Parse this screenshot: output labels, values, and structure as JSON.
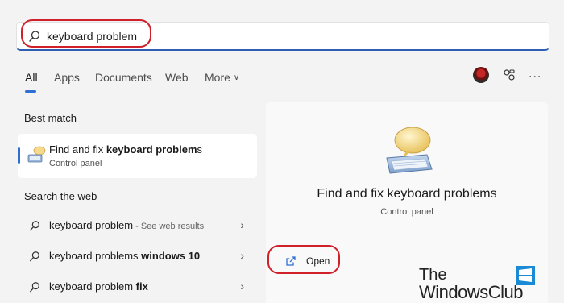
{
  "search": {
    "query": "keyboard problem"
  },
  "tabs": [
    {
      "label": "All",
      "active": true
    },
    {
      "label": "Apps"
    },
    {
      "label": "Documents"
    },
    {
      "label": "Web"
    },
    {
      "label": "More"
    }
  ],
  "header_icons": {
    "avatar": "avatar",
    "share": "share-icon",
    "more": "..."
  },
  "best_match": {
    "section": "Best match",
    "title_prefix": "Find and fix ",
    "title_bold": "keyboard problem",
    "title_suffix": "s",
    "subtitle": "Control panel"
  },
  "web": {
    "section": "Search the web",
    "items": [
      {
        "text": "keyboard problem",
        "bold": "",
        "hint": " - See web results"
      },
      {
        "text": "keyboard problems ",
        "bold": "windows 10",
        "hint": ""
      },
      {
        "text": "keyboard problem ",
        "bold": "fix",
        "hint": ""
      }
    ]
  },
  "detail": {
    "title": "Find and fix keyboard problems",
    "subtitle": "Control panel",
    "action": "Open"
  },
  "watermark": {
    "line1": "The",
    "line2": "WindowsClub"
  },
  "colors": {
    "accent": "#2f6ed2",
    "annotation": "#d0202a"
  }
}
